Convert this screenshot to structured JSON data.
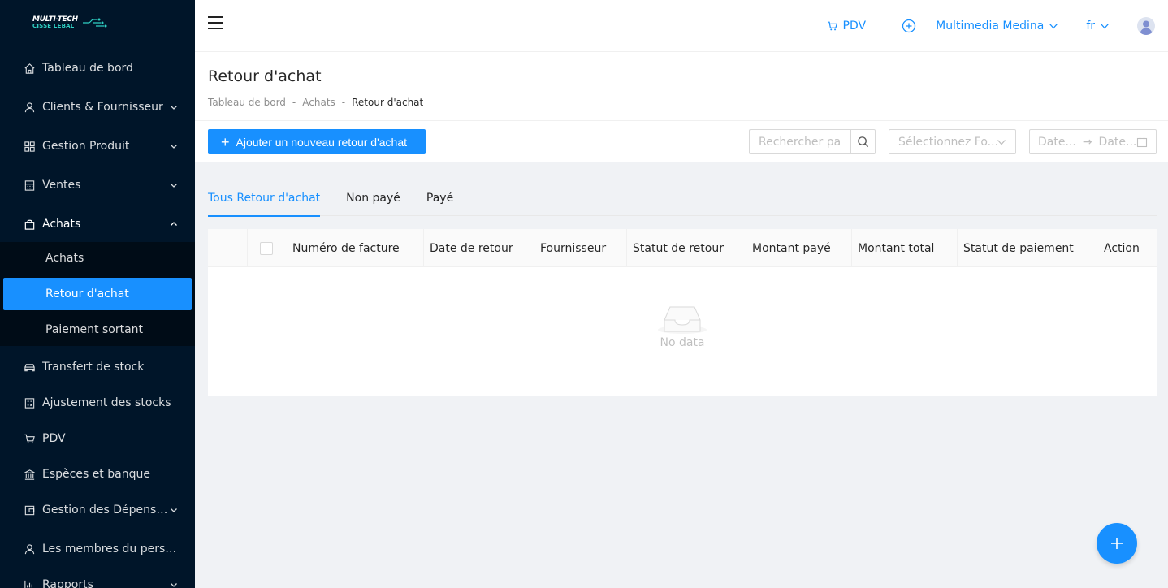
{
  "brand": {
    "logo_line1": "MULTI-TECH",
    "logo_line2": "CISSE LEBAL"
  },
  "sidebar": {
    "items": [
      {
        "label": "Tableau de bord",
        "icon": "home-icon"
      },
      {
        "label": "Clients & Fournisseur",
        "icon": "user-icon"
      },
      {
        "label": "Gestion Produit",
        "icon": "grid-icon"
      },
      {
        "label": "Ventes",
        "icon": "calculator-icon"
      },
      {
        "label": "Achats",
        "icon": "bag-icon"
      },
      {
        "label": "Transfert de stock",
        "icon": "car-icon"
      },
      {
        "label": "Ajustement des stocks",
        "icon": "calculator-icon"
      },
      {
        "label": "PDV",
        "icon": "cart-icon"
      },
      {
        "label": "Espèces et banque",
        "icon": "bank-icon"
      },
      {
        "label": "Gestion des Dépenses",
        "icon": "wallet-icon"
      },
      {
        "label": "Les membres du personnel",
        "icon": "user-icon"
      },
      {
        "label": "Rapports",
        "icon": "chart-icon"
      }
    ],
    "achats_submenu": [
      {
        "label": "Achats"
      },
      {
        "label": "Retour d'achat"
      },
      {
        "label": "Paiement sortant"
      }
    ]
  },
  "header": {
    "pdv_label": "PDV",
    "store_label": "Multimedia Medina",
    "lang_label": "fr"
  },
  "page": {
    "title": "Retour d'achat",
    "breadcrumb": [
      "Tableau de bord",
      "Achats",
      "Retour d'achat"
    ]
  },
  "toolbar": {
    "add_label": "Ajouter un nouveau retour d'achat",
    "search_placeholder": "Rechercher pa...",
    "supplier_placeholder": "Sélectionnez Fo...",
    "date_start_placeholder": "Date...",
    "date_end_placeholder": "Date..."
  },
  "tabs": [
    {
      "label": "Tous Retour d'achat",
      "active": true
    },
    {
      "label": "Non payé",
      "active": false
    },
    {
      "label": "Payé",
      "active": false
    }
  ],
  "table": {
    "columns": [
      "Numéro de facture",
      "Date de retour",
      "Fournisseur",
      "Statut de retour",
      "Montant payé",
      "Montant total",
      "Statut de paiement",
      "Action"
    ],
    "empty_text": "No data"
  },
  "colors": {
    "primary": "#1890ff",
    "sidebar_bg": "#001529",
    "submenu_bg": "#000c17"
  }
}
